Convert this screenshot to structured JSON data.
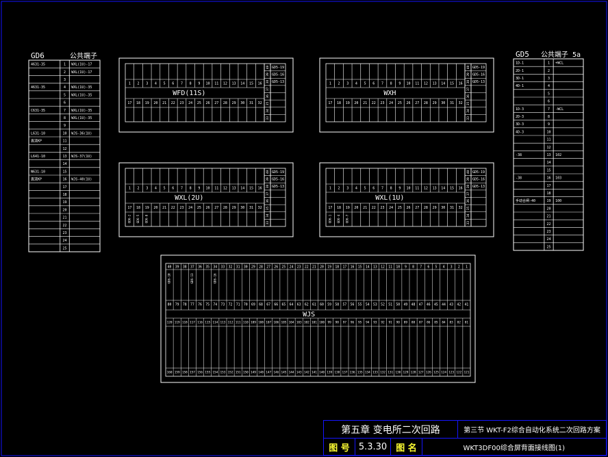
{
  "terminals": {
    "gd6": {
      "title": "GD6",
      "subtitle": "公共端子",
      "rows": [
        {
          "l": "4631-35",
          "n": "1",
          "r": "WXL(1U)-17"
        },
        {
          "l": "",
          "n": "2",
          "r": "WXL(1U)-17"
        },
        {
          "l": "",
          "n": "3",
          "r": ""
        },
        {
          "l": "4631-35",
          "n": "4",
          "r": "WXL(1U)-35"
        },
        {
          "l": "",
          "n": "5",
          "r": "WXL(1U)-35"
        },
        {
          "l": "",
          "n": "6",
          "r": ""
        },
        {
          "l": "C631-35",
          "n": "7",
          "r": "WXL(1U)-35"
        },
        {
          "l": "",
          "n": "8",
          "r": "WXL(1U)-35"
        },
        {
          "l": "",
          "n": "9",
          "r": ""
        },
        {
          "l": "L631-10",
          "n": "10",
          "r": "WJS-36(1U)"
        },
        {
          "l": "直流KP",
          "n": "11",
          "r": ""
        },
        {
          "l": "",
          "n": "12",
          "r": ""
        },
        {
          "l": "L641-10",
          "n": "13",
          "r": "WJS-37(1U)"
        },
        {
          "l": "",
          "n": "14",
          "r": ""
        },
        {
          "l": "N631-10",
          "n": "15",
          "r": ""
        },
        {
          "l": "直流KP",
          "n": "16",
          "r": "WJS-40(1U)"
        },
        {
          "l": "",
          "n": "17",
          "r": ""
        },
        {
          "l": "",
          "n": "18",
          "r": ""
        },
        {
          "l": "",
          "n": "19",
          "r": ""
        },
        {
          "l": "",
          "n": "20",
          "r": ""
        },
        {
          "l": "",
          "n": "21",
          "r": ""
        },
        {
          "l": "",
          "n": "22",
          "r": ""
        },
        {
          "l": "",
          "n": "23",
          "r": ""
        },
        {
          "l": "",
          "n": "24",
          "r": ""
        },
        {
          "l": "",
          "n": "25",
          "r": ""
        }
      ]
    },
    "gd5": {
      "title": "GD5",
      "subtitle": "公共端子 5a",
      "rows": [
        {
          "l": "1D-1",
          "n": "1",
          "r": "+WCL"
        },
        {
          "l": "2D-1",
          "n": "2",
          "r": ""
        },
        {
          "l": "3D-1",
          "n": "3",
          "r": ""
        },
        {
          "l": "4D-1",
          "n": "4",
          "r": ""
        },
        {
          "l": "",
          "n": "5",
          "r": ""
        },
        {
          "l": "",
          "n": "6",
          "r": ""
        },
        {
          "l": "1D-3",
          "n": "7",
          "r": "-WCL"
        },
        {
          "l": "2D-3",
          "n": "8",
          "r": ""
        },
        {
          "l": "3D-3",
          "n": "9",
          "r": ""
        },
        {
          "l": "4D-3",
          "n": "10",
          "r": ""
        },
        {
          "l": "",
          "n": "11",
          "r": ""
        },
        {
          "l": "",
          "n": "12",
          "r": ""
        },
        {
          "l": "-38",
          "n": "13",
          "r": "102"
        },
        {
          "l": "",
          "n": "14",
          "r": ""
        },
        {
          "l": "",
          "n": "15",
          "r": ""
        },
        {
          "l": "-38",
          "n": "16",
          "r": "103"
        },
        {
          "l": "",
          "n": "17",
          "r": ""
        },
        {
          "l": "",
          "n": "18",
          "r": ""
        },
        {
          "l": "手动合闸-40",
          "n": "19",
          "r": "100"
        },
        {
          "l": "",
          "n": "20",
          "r": ""
        },
        {
          "l": "",
          "n": "21",
          "r": ""
        },
        {
          "l": "",
          "n": "22",
          "r": ""
        },
        {
          "l": "",
          "n": "23",
          "r": ""
        },
        {
          "l": "",
          "n": "24",
          "r": ""
        },
        {
          "l": "",
          "n": "25",
          "r": ""
        }
      ]
    }
  },
  "modules": [
    {
      "id": "wfd",
      "label": "WFD(11S)",
      "side": [
        "40",
        "39",
        "38",
        "37",
        "36",
        "35",
        "34",
        "33"
      ],
      "side_labels": [
        "GD5-19",
        "GD5-16",
        "GD5-13"
      ],
      "bottom_tags": []
    },
    {
      "id": "wxh",
      "label": "WXH",
      "side": [
        "40",
        "39",
        "38",
        "37",
        "36",
        "35",
        "34",
        "33"
      ],
      "side_labels": [
        "GD5-19",
        "GD5-16",
        "GD5-13"
      ],
      "bottom_tags": []
    },
    {
      "id": "wxl2u",
      "label": "WXL(2U)",
      "side": [
        "40",
        "39",
        "38",
        "37",
        "36",
        "35",
        "34",
        "33"
      ],
      "side_labels": [
        "GD5-19",
        "GD5-16",
        "GD5-13"
      ],
      "bottom_tags": [
        "GD6-2",
        "GD6-5",
        "GD6-8"
      ]
    },
    {
      "id": "wxl1u",
      "label": "WXL(1U)",
      "side": [
        "40",
        "39",
        "38",
        "37",
        "36",
        "35",
        "34",
        "33"
      ],
      "side_labels": [
        "GD5-19",
        "GD5-16",
        "GD5-13"
      ],
      "bottom_tags": [
        "GD6-1",
        "GD6-4",
        "GD6-7"
      ]
    }
  ],
  "module_top_numbers": [
    "1",
    "2",
    "3",
    "4",
    "5",
    "6",
    "7",
    "8",
    "9",
    "10",
    "11",
    "12",
    "13",
    "14",
    "15",
    "16"
  ],
  "module_bottom_numbers": [
    "17",
    "18",
    "19",
    "20",
    "21",
    "22",
    "23",
    "24",
    "25",
    "26",
    "27",
    "28",
    "29",
    "30",
    "31",
    "32"
  ],
  "wjs": {
    "label": "WJS",
    "row1": [
      "40",
      "39",
      "38",
      "37",
      "36",
      "35",
      "34",
      "33",
      "32",
      "31",
      "30",
      "29",
      "28",
      "27",
      "26",
      "25",
      "24",
      "23",
      "22",
      "21",
      "20",
      "19",
      "18",
      "17",
      "16",
      "15",
      "14",
      "13",
      "12",
      "11",
      "10",
      "9",
      "8",
      "7",
      "6",
      "5",
      "4",
      "3",
      "2",
      "1"
    ],
    "row1_tags": [
      "GD6-10",
      "GD6-13",
      "GD6-16"
    ],
    "row2": [
      "80",
      "79",
      "78",
      "77",
      "76",
      "75",
      "74",
      "73",
      "72",
      "71",
      "70",
      "69",
      "68",
      "67",
      "66",
      "65",
      "64",
      "63",
      "62",
      "61",
      "60",
      "59",
      "58",
      "57",
      "56",
      "55",
      "54",
      "53",
      "52",
      "51",
      "50",
      "49",
      "48",
      "47",
      "46",
      "45",
      "44",
      "43",
      "42",
      "41"
    ],
    "row3": [
      "120",
      "119",
      "118",
      "117",
      "116",
      "115",
      "114",
      "113",
      "112",
      "111",
      "110",
      "109",
      "108",
      "107",
      "106",
      "105",
      "104",
      "103",
      "102",
      "101",
      "100",
      "99",
      "98",
      "97",
      "96",
      "95",
      "94",
      "93",
      "92",
      "91",
      "90",
      "89",
      "88",
      "87",
      "86",
      "85",
      "84",
      "83",
      "82",
      "81"
    ],
    "row4": [
      "160",
      "159",
      "158",
      "157",
      "156",
      "155",
      "154",
      "153",
      "152",
      "151",
      "150",
      "149",
      "148",
      "147",
      "146",
      "145",
      "144",
      "143",
      "142",
      "141",
      "140",
      "139",
      "138",
      "137",
      "136",
      "135",
      "134",
      "133",
      "132",
      "131",
      "130",
      "129",
      "128",
      "127",
      "126",
      "125",
      "124",
      "123",
      "122",
      "121"
    ]
  },
  "title_block": {
    "chapter": "第五章  变电所二次回路",
    "section": "第三节 WKT-F2综合自动化系统二次回路方案",
    "fig_no_label": "图  号",
    "fig_no": "5.3.30",
    "fig_name_label": "图  名",
    "fig_name": "WKT3DF00综合屏背面接线图(1)"
  },
  "colors": {
    "line": "#ffffff",
    "border": "#1515ff",
    "highlight": "#ffff33"
  }
}
